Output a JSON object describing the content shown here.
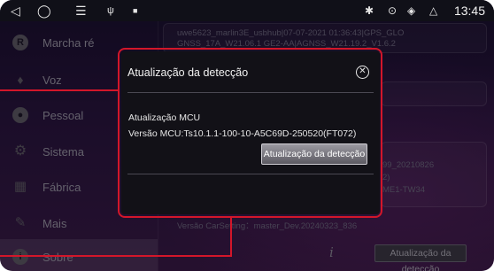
{
  "statusbar": {
    "time": "13:45",
    "left_icons": [
      "back-icon",
      "home-icon",
      "menu-icon",
      "usb-icon",
      "photo-icon"
    ],
    "right_icons": [
      "bluetooth-icon",
      "location-icon",
      "wifi-icon",
      "eject-icon"
    ]
  },
  "sidebar": {
    "items": [
      {
        "label": "Marcha ré",
        "icon": "reverse-icon",
        "glyph": "R"
      },
      {
        "label": "Voz",
        "icon": "microphone-icon",
        "glyph": "🎤"
      },
      {
        "label": "Pessoal",
        "icon": "person-icon",
        "glyph": "●"
      },
      {
        "label": "Sistema",
        "icon": "gears-icon",
        "glyph": "⚙"
      },
      {
        "label": "Fábrica",
        "icon": "factory-icon",
        "glyph": "▦"
      },
      {
        "label": "Mais",
        "icon": "wrench-icon",
        "glyph": "🔧"
      },
      {
        "label": "Sobre",
        "icon": "info-icon",
        "glyph": "i"
      }
    ],
    "active_index": 6
  },
  "info": {
    "line1": "uwe5623_marlin3E_usbhub|07-07-2021 01:36:43|GPS_GLO",
    "line2": "GNSS_17A_W21.06.1 GE2-AA|AGNSS_W21.19.2_V1.6.2",
    "frag1": "99_20210826",
    "frag2": "2)",
    "frag3": "ME1-TW34",
    "carsetting": "Versão CarSetting：master_Dev.20240323_836",
    "button": "Atualização da detecção"
  },
  "dialog": {
    "title": "Atualização da detecção",
    "close_icon": "close-icon",
    "mcu_label": "Atualização MCU",
    "mcu_version": "Versão MCU:Ts10.1.1-100-10-A5C69D-250520(FT072)",
    "button": "Atualização da detecção"
  },
  "colors": {
    "annotation": "#d3162a",
    "dialog_bg": "#121117",
    "background": "#2a1540"
  }
}
